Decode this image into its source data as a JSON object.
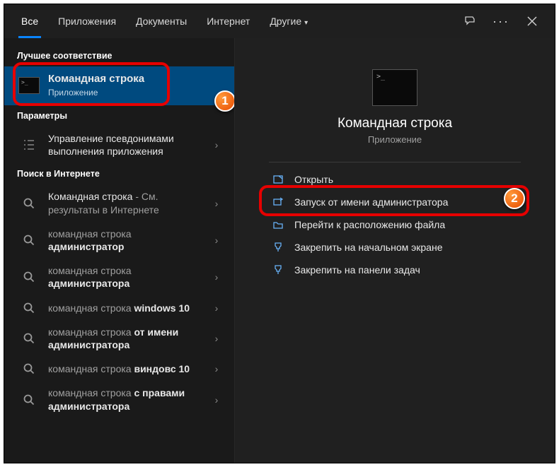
{
  "tabs": {
    "all": "Все",
    "apps": "Приложения",
    "docs": "Документы",
    "web": "Интернет",
    "more": "Другие"
  },
  "sections": {
    "best": "Лучшее соответствие",
    "settings": "Параметры",
    "web": "Поиск в Интернете"
  },
  "best_match": {
    "title": "Командная строка",
    "subtitle": "Приложение"
  },
  "settings_items": [
    {
      "label": "Управление псевдонимами выполнения приложения"
    }
  ],
  "web_items": [
    {
      "prefix": "Командная строка",
      "suffix": " - См. результаты в Интернете"
    },
    {
      "prefix": "командная строка ",
      "bold": "администратор"
    },
    {
      "prefix": "командная строка ",
      "bold": "администратора"
    },
    {
      "prefix": "командная строка ",
      "bold": "windows 10"
    },
    {
      "prefix": "командная строка ",
      "bold": "от имени администратора"
    },
    {
      "prefix": "командная строка ",
      "bold": "виндовс 10"
    },
    {
      "prefix": "командная строка ",
      "bold": "с правами администратора"
    }
  ],
  "preview": {
    "title": "Командная строка",
    "subtitle": "Приложение"
  },
  "actions": {
    "open": "Открыть",
    "run_admin": "Запуск от имени администратора",
    "open_location": "Перейти к расположению файла",
    "pin_start": "Закрепить на начальном экране",
    "pin_taskbar": "Закрепить на панели задач"
  },
  "badges": {
    "one": "1",
    "two": "2"
  }
}
